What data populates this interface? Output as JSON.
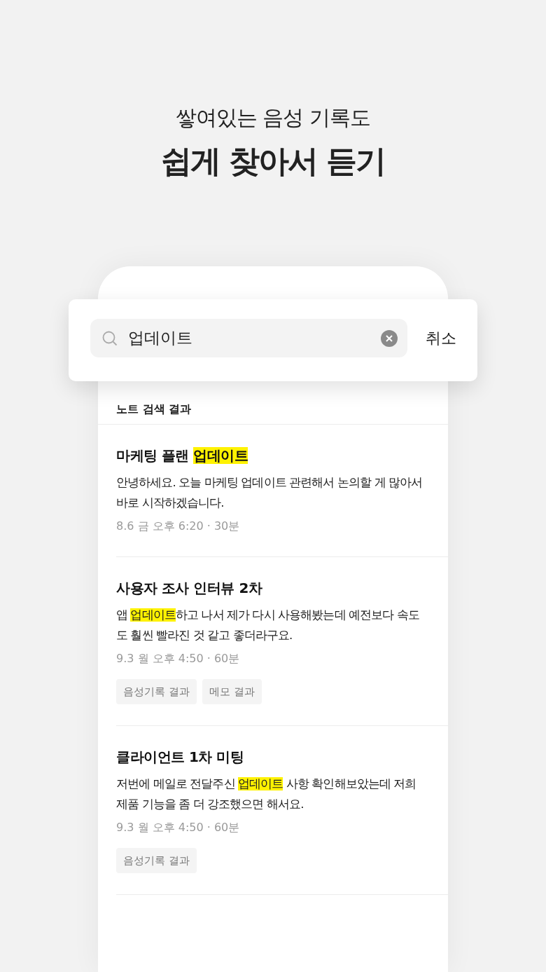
{
  "headline": {
    "subtitle": "쌓여있는 음성 기록도",
    "title": "쉽게 찾아서 듣기"
  },
  "search": {
    "value": "업데이트",
    "cancel": "취소"
  },
  "section_title": "노트 검색 결과",
  "results": [
    {
      "title": [
        {
          "text": "마케팅 플랜 ",
          "highlighted": false
        },
        {
          "text": "업데이트",
          "highlighted": true
        }
      ],
      "snippet": [
        {
          "text": "안녕하세요. 오늘 마케팅 업데이트 관련해서 논의할 게 많아서 바로 시작하겠습니다.",
          "highlighted": false
        }
      ],
      "meta": "8.6 금 오후 6:20 · 30분"
    },
    {
      "title": [
        {
          "text": "사용자 조사 인터뷰 2차",
          "highlighted": false
        }
      ],
      "snippet": [
        {
          "text": "앱 ",
          "highlighted": false
        },
        {
          "text": "업데이트",
          "highlighted": true
        },
        {
          "text": "하고 나서 제가 다시 사용해봤는데 예전보다 속도도 훨씬 빨라진 것 같고 좋더라구요.",
          "highlighted": false
        }
      ],
      "meta": "9.3 월 오후 4:50 · 60분",
      "tags": [
        "음성기록 결과",
        "메모 결과"
      ]
    },
    {
      "title": [
        {
          "text": "클라이언트 1차 미팅",
          "highlighted": false
        }
      ],
      "snippet": [
        {
          "text": "저번에 메일로 전달주신 ",
          "highlighted": false
        },
        {
          "text": "업데이트",
          "highlighted": true
        },
        {
          "text": " 사항 확인해보았는데 저희 제품 기능을 좀 더 강조했으면 해서요.",
          "highlighted": false
        }
      ],
      "meta": "9.3 월 오후 4:50 · 60분",
      "tags": [
        "음성기록 결과"
      ]
    }
  ]
}
